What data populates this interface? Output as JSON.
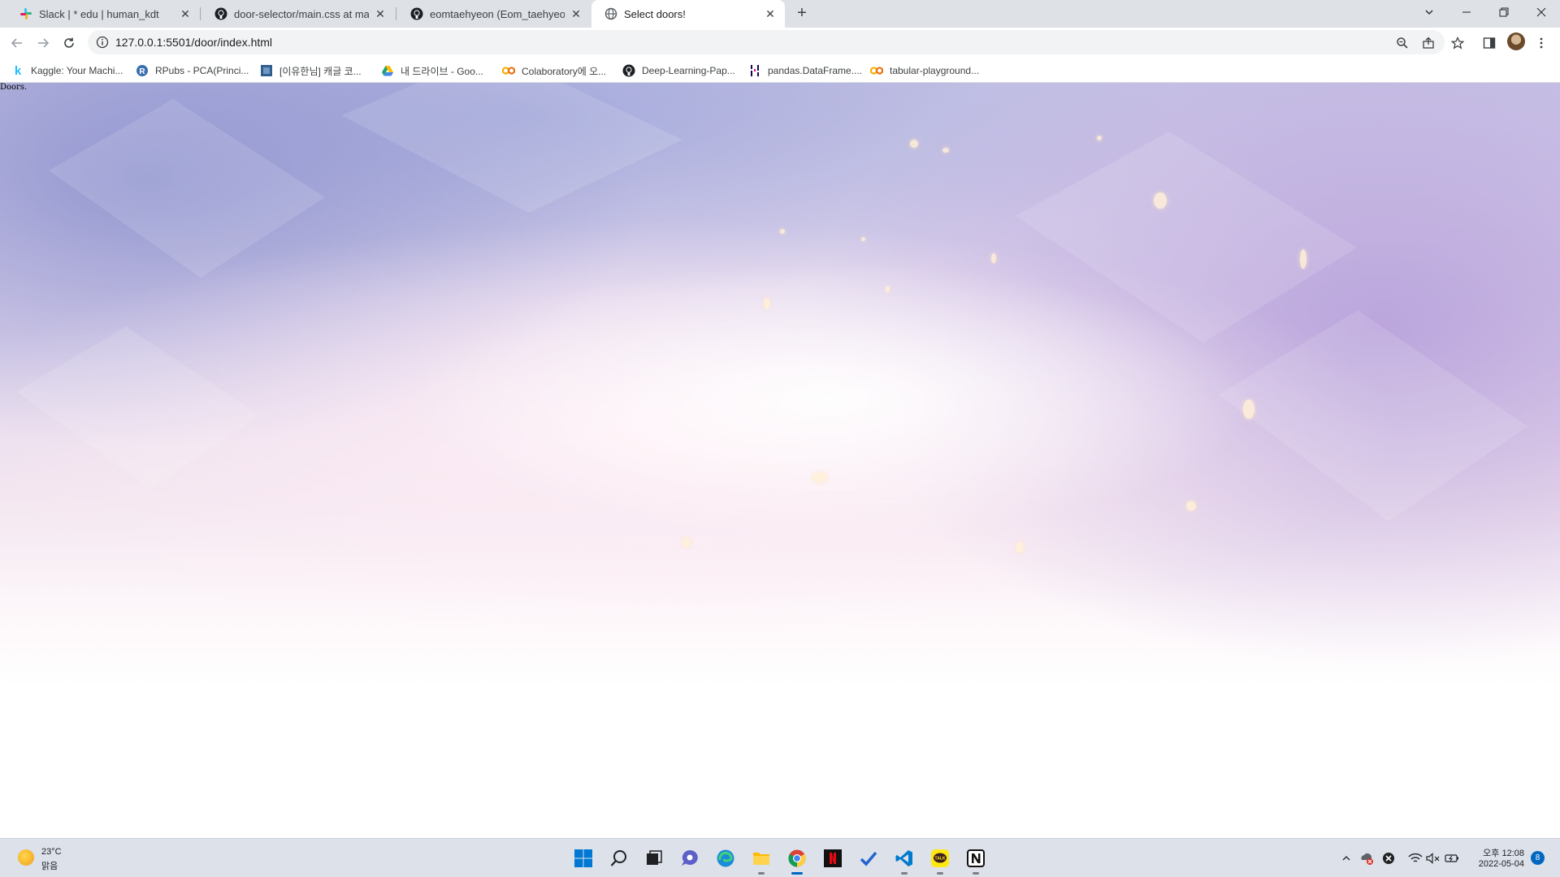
{
  "browser": {
    "tabs": [
      {
        "title": "Slack | * edu | human_kdt",
        "icon": "slack-icon"
      },
      {
        "title": "door-selector/main.css at main",
        "icon": "github-icon"
      },
      {
        "title": "eomtaehyeon (Eom_taehyeon)",
        "icon": "github-icon"
      },
      {
        "title": "Select doors!",
        "icon": "globe-icon"
      }
    ],
    "active_tab": 3,
    "new_tab_label": "+",
    "url": "127.0.0.1:5501/door/index.html"
  },
  "bookmarks": [
    {
      "label": "Kaggle: Your Machi...",
      "icon": "kaggle-icon",
      "glyph": "k",
      "color": "#20beff"
    },
    {
      "label": "RPubs - PCA(Princi...",
      "icon": "rpubs-icon",
      "glyph": "R",
      "color": "#3a6fb0"
    },
    {
      "label": "[이유한님] 캐글 코...",
      "icon": "kaggle-kr-icon",
      "glyph": "K",
      "color": "#2f5f8f"
    },
    {
      "label": "내 드라이브 - Goo...",
      "icon": "google-drive-icon",
      "glyph": "▲",
      "color": "#1fa463"
    },
    {
      "label": "Colaboratory에 오...",
      "icon": "colab-icon",
      "glyph": "CO",
      "color": "#f9ab00"
    },
    {
      "label": "Deep-Learning-Pap...",
      "icon": "github-icon",
      "glyph": "",
      "color": "#1b1f23"
    },
    {
      "label": "pandas.DataFrame....",
      "icon": "pandas-icon",
      "glyph": "▌▌",
      "color": "#150458"
    },
    {
      "label": "tabular-playground...",
      "icon": "colab-icon",
      "glyph": "CO",
      "color": "#f9ab00"
    }
  ],
  "page": {
    "text": "Doors."
  },
  "taskbar": {
    "weather": {
      "temp": "23°C",
      "condition": "맑음"
    },
    "apps": [
      {
        "name": "start",
        "icon": "windows-start-icon"
      },
      {
        "name": "search",
        "icon": "search-icon"
      },
      {
        "name": "task-view",
        "icon": "task-view-icon"
      },
      {
        "name": "chat",
        "icon": "teams-chat-icon"
      },
      {
        "name": "edge",
        "icon": "edge-icon"
      },
      {
        "name": "file-explorer",
        "icon": "folder-icon"
      },
      {
        "name": "chrome",
        "icon": "chrome-icon"
      },
      {
        "name": "netflix",
        "icon": "netflix-icon"
      },
      {
        "name": "todo",
        "icon": "todo-check-icon"
      },
      {
        "name": "vscode",
        "icon": "vscode-icon"
      },
      {
        "name": "kakaotalk",
        "icon": "kakaotalk-icon",
        "label": "TALK"
      },
      {
        "name": "notion",
        "icon": "notion-icon",
        "label": "N"
      }
    ],
    "clock": {
      "time": "오후 12:08",
      "date": "2022-05-04"
    },
    "notifications": "8"
  }
}
